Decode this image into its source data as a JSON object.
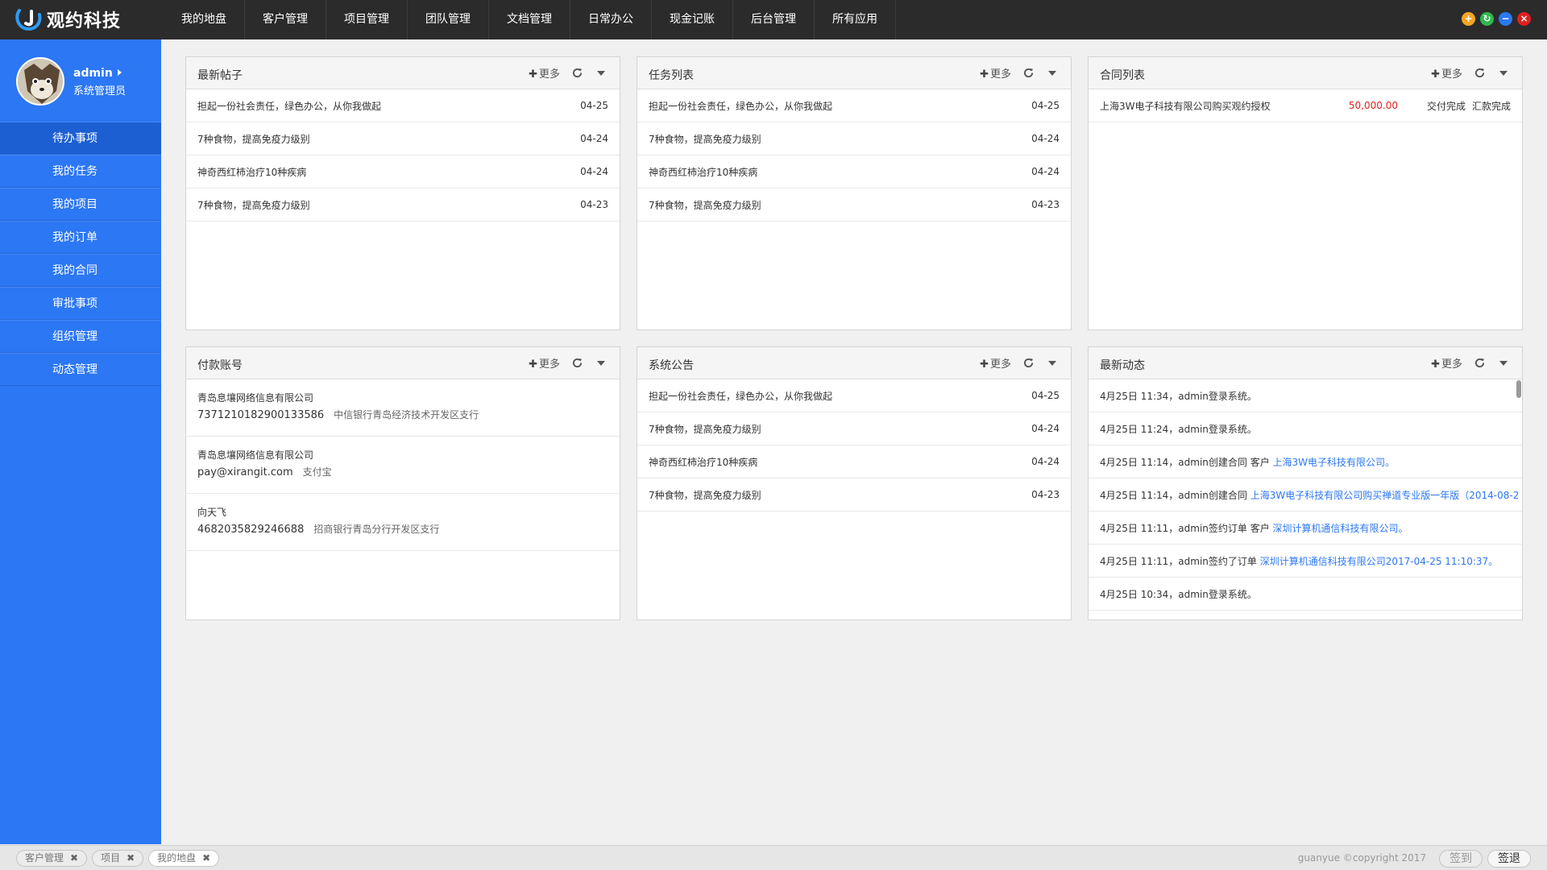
{
  "brand": {
    "name": "观约科技",
    "accent": "#2c77f4"
  },
  "nav": [
    "我的地盘",
    "客户管理",
    "项目管理",
    "团队管理",
    "文档管理",
    "日常办公",
    "现金记账",
    "后台管理",
    "所有应用"
  ],
  "window_controls": [
    {
      "icon": "plus-icon",
      "glyph": "+",
      "color": "#f5a623"
    },
    {
      "icon": "refresh-icon",
      "glyph": "↻",
      "color": "#2db84d"
    },
    {
      "icon": "minus-icon",
      "glyph": "−",
      "color": "#2c77f4"
    },
    {
      "icon": "close-icon",
      "glyph": "×",
      "color": "#e02020"
    }
  ],
  "user": {
    "name": "admin",
    "role": "系统管理员"
  },
  "menu": [
    "待办事项",
    "我的任务",
    "我的项目",
    "我的订单",
    "我的合同",
    "审批事项",
    "组织管理",
    "动态管理"
  ],
  "more_label": "更多",
  "panels": {
    "posts": {
      "title": "最新帖子",
      "items": [
        {
          "text": "担起一份社会责任，绿色办公，从你我做起",
          "date": "04-25"
        },
        {
          "text": "7种食物，提高免疫力级别",
          "date": "04-24"
        },
        {
          "text": "神奇西红柿治疗10种疾病",
          "date": "04-24"
        },
        {
          "text": "7种食物，提高免疫力级别",
          "date": "04-23"
        }
      ]
    },
    "tasks": {
      "title": "任务列表",
      "items": [
        {
          "text": "担起一份社会责任，绿色办公，从你我做起",
          "date": "04-25"
        },
        {
          "text": "7种食物，提高免疫力级别",
          "date": "04-24"
        },
        {
          "text": "神奇西红柿治疗10种疾病",
          "date": "04-24"
        },
        {
          "text": "7种食物，提高免疫力级别",
          "date": "04-23"
        }
      ]
    },
    "contracts": {
      "title": "合同列表",
      "items": [
        {
          "name": "上海3W电子科技有限公司购买观约授权",
          "amount": "50,000.00",
          "delivery": "交付完成",
          "payment": "汇款完成"
        }
      ]
    },
    "accounts": {
      "title": "付款账号",
      "items": [
        {
          "name": "青岛息壤网络信息有限公司",
          "account": "7371210182900133586",
          "bank": "中信银行青岛经济技术开发区支行"
        },
        {
          "name": "青岛息壤网络信息有限公司",
          "account": "pay@xirangit.com",
          "bank": "支付宝"
        },
        {
          "name": "向天飞",
          "account": "4682035829246688",
          "bank": "招商银行青岛分行开发区支行"
        }
      ]
    },
    "notices": {
      "title": "系统公告",
      "items": [
        {
          "text": "担起一份社会责任，绿色办公，从你我做起",
          "date": "04-25"
        },
        {
          "text": "7种食物，提高免疫力级别",
          "date": "04-24"
        },
        {
          "text": "神奇西红柿治疗10种疾病",
          "date": "04-24"
        },
        {
          "text": "7种食物，提高免疫力级别",
          "date": "04-23"
        }
      ]
    },
    "feed": {
      "title": "最新动态",
      "items": [
        {
          "text": "4月25日 11:34，admin登录系统。",
          "link": ""
        },
        {
          "text": "4月25日 11:24，admin登录系统。",
          "link": ""
        },
        {
          "text": "4月25日 11:14，admin创建合同 客户 ",
          "link": "上海3W电子科技有限公司。"
        },
        {
          "text": "4月25日 11:14，admin创建合同 ",
          "link": "上海3W电子科技有限公司购买禅道专业版一年版（2014-08-2"
        },
        {
          "text": "4月25日 11:11，admin签约订单 客户 ",
          "link": "深圳计算机通信科技有限公司。"
        },
        {
          "text": "4月25日 11:11，admin签约了订单 ",
          "link": "深圳计算机通信科技有限公司2017-04-25 11:10:37。"
        },
        {
          "text": "4月25日 10:34，admin登录系统。",
          "link": ""
        }
      ]
    }
  },
  "bottom": {
    "tabs": [
      "客户管理",
      "项目",
      "我的地盘"
    ],
    "copyright": "guanyue ©copyright 2017",
    "checkin": "签到",
    "checkout": "签退"
  }
}
